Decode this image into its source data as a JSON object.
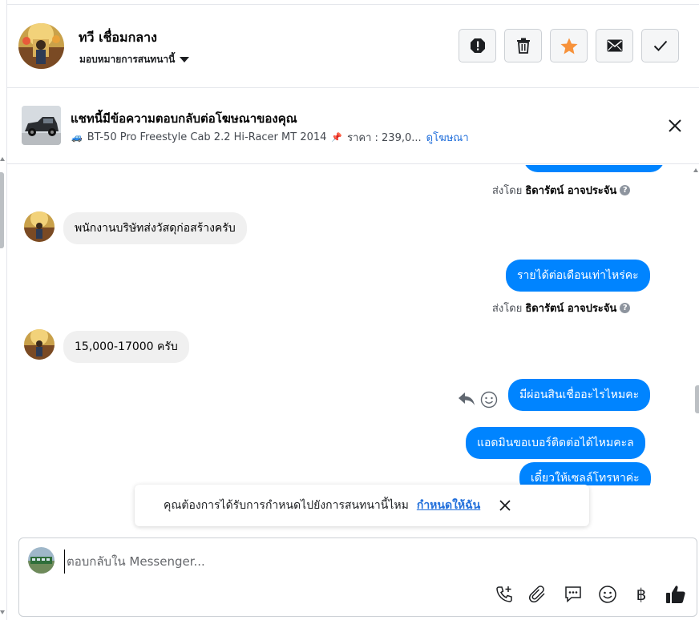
{
  "header": {
    "contact_name": "ทวี เชื่อมกลาง",
    "assign_label": "มอบหมายการสนทนานี้",
    "buttons": [
      "spam-icon",
      "trash-icon",
      "star-icon",
      "envelope-icon",
      "check-icon"
    ],
    "star_color": "#f7923b"
  },
  "ad": {
    "title": "แชทนี้มีข้อความตอบกลับต่อโฆษณาของคุณ",
    "car_emoji": "🚙",
    "product": "BT-50 Pro Freestyle Cab 2.2 Hi-Racer MT 2014",
    "pin_emoji": "📌",
    "price": "ราคา : 239,0...",
    "link": "ดูโฆษณา"
  },
  "messages": [
    {
      "type": "outgoing",
      "text": ""
    },
    {
      "type": "sentby",
      "prefix": "ส่งโดย",
      "name": "ธิดารัตน์ อาจประจัน"
    },
    {
      "type": "incoming",
      "text": "พนักงานบริษัทส่งวัสดุก่อสร้างครับ"
    },
    {
      "type": "outgoing",
      "text": "รายได้ต่อเดือนเท่าไหร่คะ"
    },
    {
      "type": "sentby",
      "prefix": "ส่งโดย",
      "name": "ธิดารัตน์ อาจประจัน"
    },
    {
      "type": "incoming",
      "text": "15,000-17000 ครับ"
    },
    {
      "type": "outgoing",
      "text": "มีผ่อนสินเชื่ออะไรไหมคะ"
    },
    {
      "type": "outgoing",
      "text": "แอดมินขอเบอร์ติดต่อได้ไหมคะล"
    },
    {
      "type": "outgoing",
      "text": "เดี๋ยวให้เซลล์โทรหาค่ะ"
    }
  ],
  "toast": {
    "text": "คุณต้องการได้รับการกำหนดไปยังการสนทนานี้ไหม",
    "link": "กำหนดให้ฉัน"
  },
  "composer": {
    "placeholder": "ตอบกลับใน Messenger...",
    "tools": [
      "phone-plus-icon",
      "paperclip-icon",
      "chat-bubble-icon",
      "emoji-icon",
      "baht-icon",
      "thumbs-up-icon"
    ],
    "baht_symbol": "฿"
  },
  "colors": {
    "bubble_out": "#0084ff",
    "bubble_in": "#f0f0f0",
    "link": "#216fdb"
  }
}
